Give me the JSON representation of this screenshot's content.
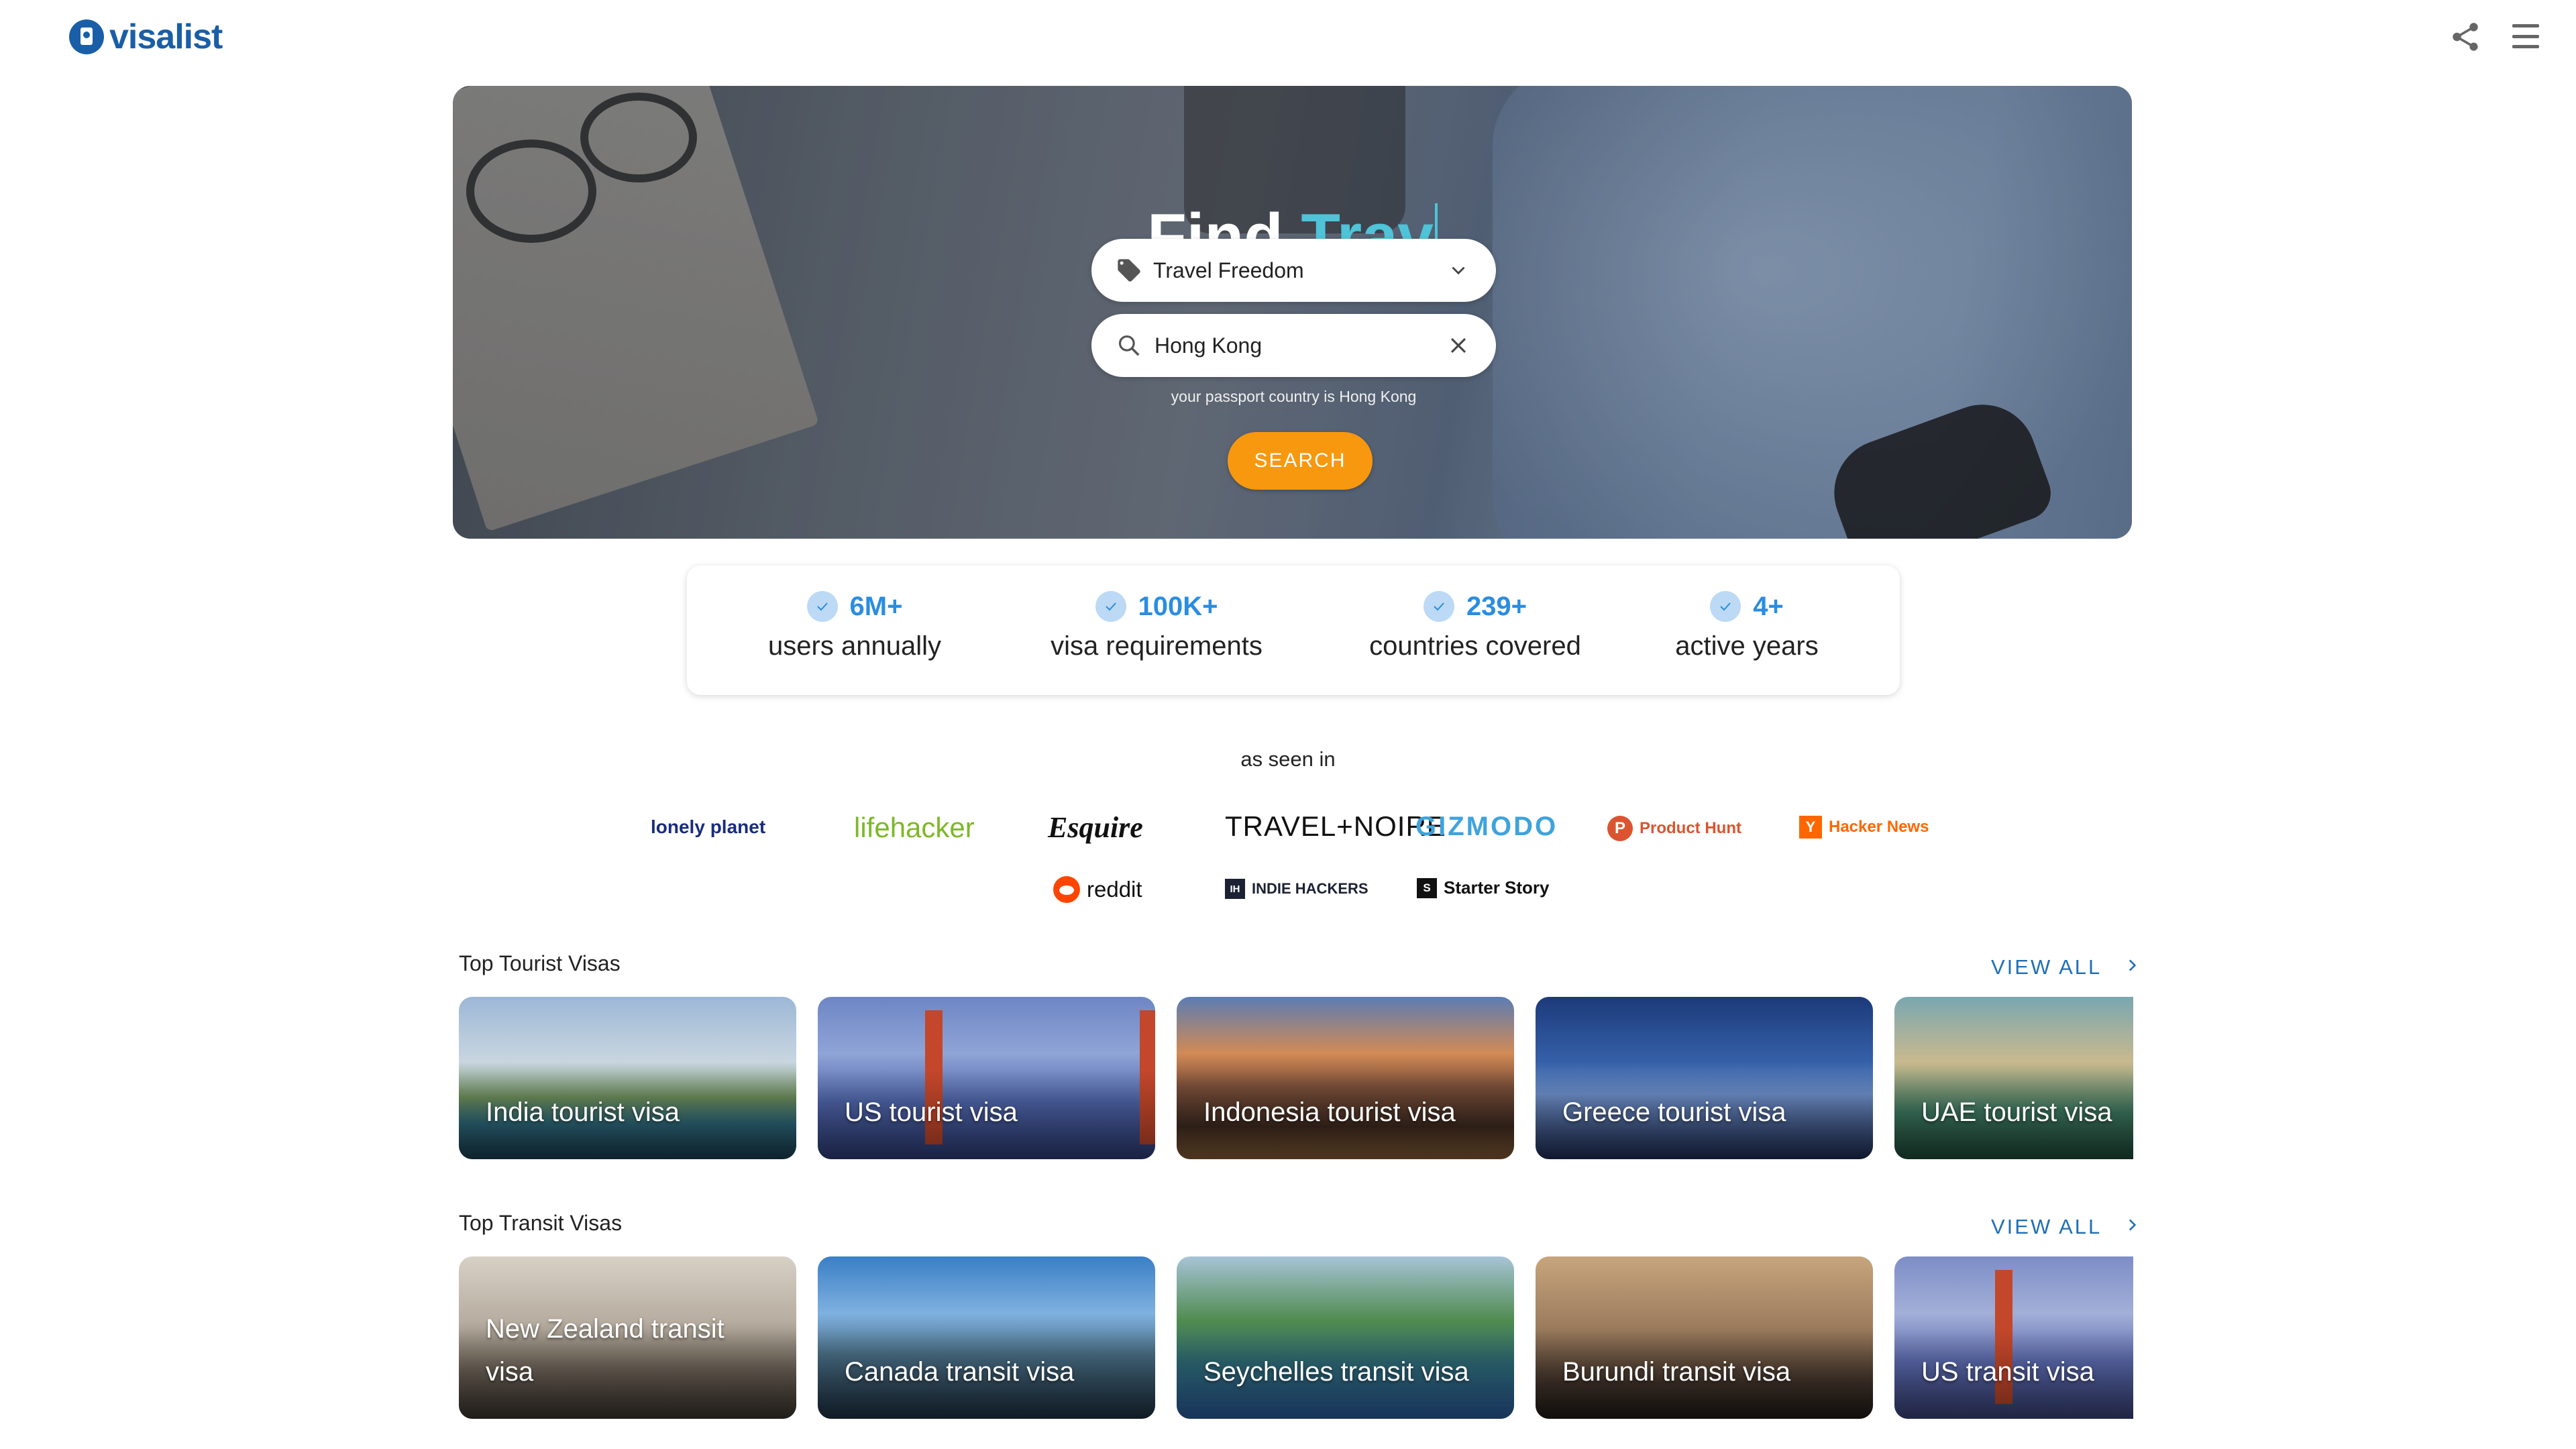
{
  "header": {
    "logo_text": "visalist",
    "share_icon": "share-icon",
    "menu_icon": "hamburger-menu-icon"
  },
  "hero": {
    "title_prefix": "Find ",
    "title_typed": "Trav",
    "select_value": "Travel Freedom",
    "search_value": "Hong Kong",
    "passport_note": "your passport country is Hong Kong",
    "search_button": "SEARCH",
    "accent_color": "#4fc3d8",
    "button_color": "#f7980f"
  },
  "stats": [
    {
      "number": "6M+",
      "label": "users annually"
    },
    {
      "number": "100K+",
      "label": "visa requirements"
    },
    {
      "number": "239+",
      "label": "countries covered"
    },
    {
      "number": "4+",
      "label": "active years"
    }
  ],
  "press": {
    "title": "as seen in",
    "logos": [
      "lonely planet",
      "lifehacker",
      "Esquire",
      "TRAVEL+NOIRE",
      "GIZMODO",
      "Product Hunt",
      "Hacker News",
      "reddit",
      "INDIE HACKERS",
      "Starter Story"
    ]
  },
  "tourist": {
    "title": "Top Tourist Visas",
    "view_all": "VIEW ALL",
    "cards": [
      "India tourist visa",
      "US tourist visa",
      "Indonesia tourist visa",
      "Greece tourist visa",
      "UAE tourist visa"
    ]
  },
  "transit": {
    "title": "Top Transit Visas",
    "view_all": "VIEW ALL",
    "cards": [
      "New Zealand transit visa",
      "Canada transit visa",
      "Seychelles transit visa",
      "Burundi transit visa",
      "US transit visa"
    ]
  }
}
